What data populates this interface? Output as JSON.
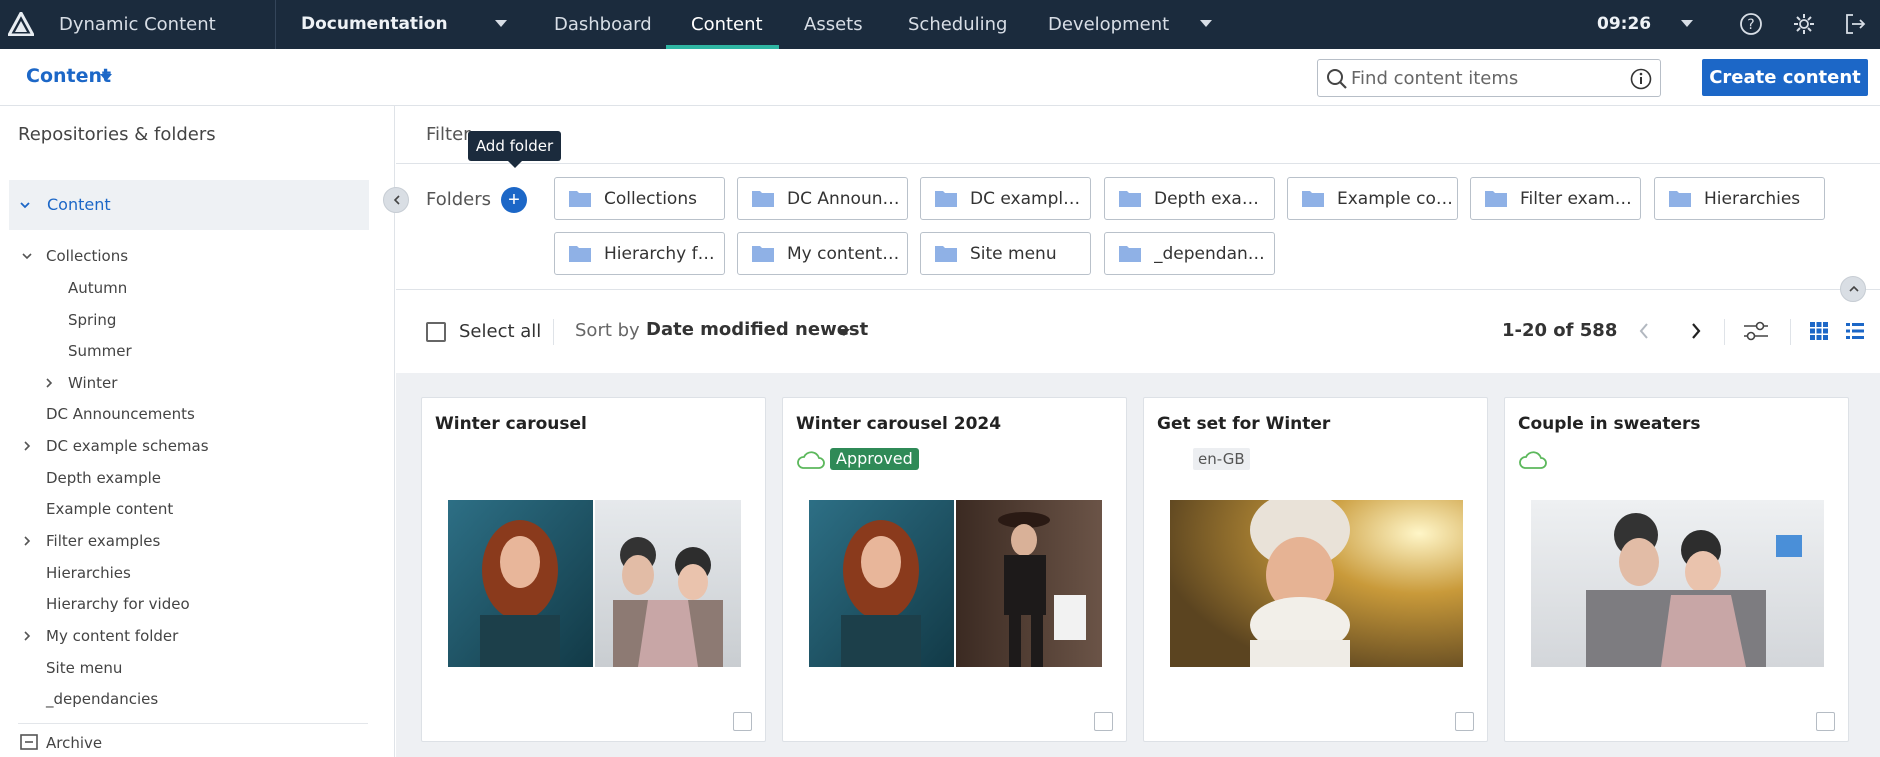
{
  "topnav": {
    "app_name": "Dynamic Content",
    "hub": "Documentation",
    "tabs": [
      "Dashboard",
      "Content",
      "Assets",
      "Scheduling",
      "Development"
    ],
    "active_tab": "Content",
    "time": "09:26",
    "colors": {
      "bg": "#1b2b3d",
      "active_underline": "#2fb6a3"
    }
  },
  "subbar": {
    "content_dropdown": "Content",
    "search_placeholder": "Find content items",
    "create_label": "Create content",
    "accent": "#1c67c7"
  },
  "sidebar": {
    "title": "Repositories & folders",
    "root": "Content",
    "items": [
      {
        "label": "Collections",
        "expanded": true
      },
      {
        "label": "Autumn"
      },
      {
        "label": "Spring"
      },
      {
        "label": "Summer"
      },
      {
        "label": "Winter",
        "expandable": true
      },
      {
        "label": "DC Announcements"
      },
      {
        "label": "DC example schemas",
        "expandable": true
      },
      {
        "label": "Depth example"
      },
      {
        "label": "Example content"
      },
      {
        "label": "Filter examples",
        "expandable": true
      },
      {
        "label": "Hierarchies"
      },
      {
        "label": "Hierarchy for video"
      },
      {
        "label": "My content folder",
        "expandable": true
      },
      {
        "label": "Site menu"
      },
      {
        "label": "_dependancies"
      }
    ],
    "archive": "Archive"
  },
  "filter": {
    "label": "Filter",
    "tooltip": "Add folder"
  },
  "folders": {
    "label": "Folders",
    "chips": [
      "Collections",
      "DC Announcements",
      "DC example schemas",
      "Depth example",
      "Example content",
      "Filter examples",
      "Hierarchies",
      "Hierarchy for video",
      "My content folder",
      "Site menu",
      "_dependancies"
    ]
  },
  "toolbar": {
    "select_all": "Select all",
    "sort_by": "Sort by",
    "sort_value": "Date modified newest",
    "count": "1-20 of 588"
  },
  "cards": [
    {
      "title": "Winter carousel",
      "status": "",
      "badge": "",
      "locale": ""
    },
    {
      "title": "Winter carousel 2024",
      "status": "cloud-icon",
      "badge": "Approved",
      "locale": ""
    },
    {
      "title": "Get set for Winter",
      "status": "",
      "badge": "",
      "locale": "en-GB"
    },
    {
      "title": "Couple in sweaters",
      "status": "cloud-icon",
      "badge": "",
      "locale": ""
    }
  ]
}
